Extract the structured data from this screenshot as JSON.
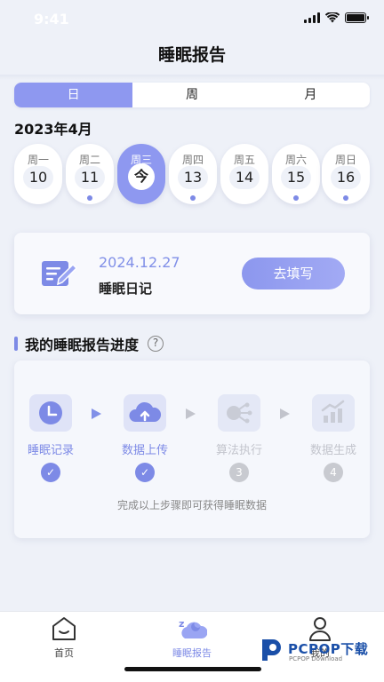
{
  "status": {
    "time": "9:41"
  },
  "header": {
    "title": "睡眠报告"
  },
  "tabs": [
    {
      "label": "日",
      "active": true
    },
    {
      "label": "周",
      "active": false
    },
    {
      "label": "月",
      "active": false
    }
  ],
  "month_label": "2023年4月",
  "days": [
    {
      "weekday": "周一",
      "num": "10",
      "dot": false,
      "today": false
    },
    {
      "weekday": "周二",
      "num": "11",
      "dot": true,
      "today": false
    },
    {
      "weekday": "周三",
      "num": "今",
      "dot": false,
      "today": true
    },
    {
      "weekday": "周四",
      "num": "13",
      "dot": true,
      "today": false
    },
    {
      "weekday": "周五",
      "num": "14",
      "dot": false,
      "today": false
    },
    {
      "weekday": "周六",
      "num": "15",
      "dot": true,
      "today": false
    },
    {
      "weekday": "周日",
      "num": "16",
      "dot": true,
      "today": false
    }
  ],
  "diary": {
    "date": "2024.12.27",
    "label": "睡眠日记",
    "button": "去填写",
    "icon": "diary-edit-icon"
  },
  "progress": {
    "title": "我的睡眠报告进度",
    "help": "?",
    "steps": [
      {
        "name": "睡眠记录",
        "done": true,
        "badge": "✓",
        "icon": "clock-icon"
      },
      {
        "name": "数据上传",
        "done": true,
        "badge": "✓",
        "icon": "cloud-upload-icon"
      },
      {
        "name": "算法执行",
        "done": false,
        "badge": "3",
        "icon": "algorithm-icon"
      },
      {
        "name": "数据生成",
        "done": false,
        "badge": "4",
        "icon": "chart-icon"
      }
    ],
    "hint": "完成以上步骤即可获得睡眠数据"
  },
  "nav": [
    {
      "label": "首页",
      "icon": "home-icon",
      "active": false
    },
    {
      "label": "睡眠报告",
      "icon": "sleep-report-icon",
      "active": true
    },
    {
      "label": "我的",
      "icon": "profile-icon",
      "active": false
    }
  ],
  "watermark": {
    "text": "PCPOP下载",
    "sub": "PCPOP Download"
  },
  "colors": {
    "accent": "#8e98f0",
    "accent_dark": "#7d8ae6",
    "background": "#eef1f8",
    "inactive": "#c2c4cc"
  }
}
